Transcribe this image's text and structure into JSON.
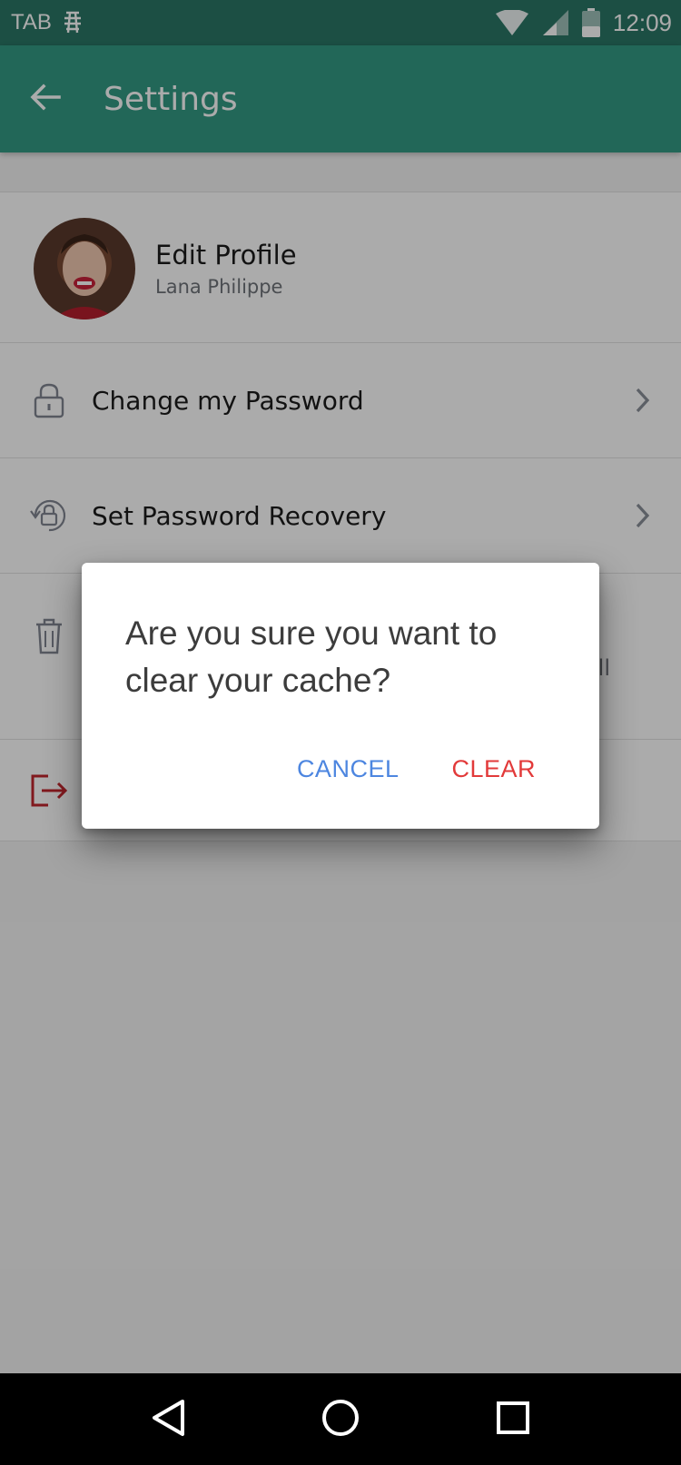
{
  "status_bar": {
    "carrier": "TAB",
    "time": "12:09",
    "icons": [
      "network-hash-icon",
      "wifi-icon",
      "cell-signal-icon",
      "battery-icon"
    ]
  },
  "app_bar": {
    "title": "Settings",
    "back_icon": "arrow-left-icon"
  },
  "profile": {
    "title": "Edit Profile",
    "name": "Lana Philippe"
  },
  "settings": {
    "items": [
      {
        "label": "Change my Password",
        "icon": "lock-icon"
      },
      {
        "label": "Set Password Recovery",
        "icon": "lock-recovery-icon"
      }
    ],
    "partial_text": "ll"
  },
  "dialog": {
    "message": "Are you sure you want to clear your cache?",
    "cancel_label": "CANCEL",
    "clear_label": "CLEAR"
  },
  "colors": {
    "status_bar": "#2a7766",
    "app_bar": "#349a84",
    "cancel": "#4d86e0",
    "clear": "#e23a3a",
    "logout_icon": "#c0262e"
  }
}
